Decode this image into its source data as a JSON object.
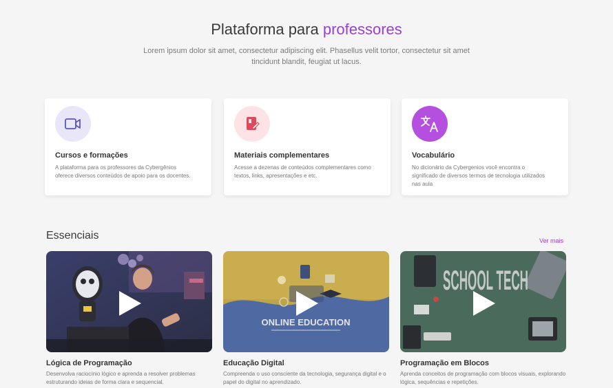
{
  "hero": {
    "title_main": "Plataforma para ",
    "title_accent": "professores",
    "subtitle": "Lorem ipsum dolor sit amet, consectetur adipiscing elit. Phasellus velit tortor, consectetur sit amet tincidunt blandit, feugiat ut lacus."
  },
  "features": [
    {
      "icon": "video-camera-icon",
      "icon_bg": "#e9e6f7",
      "icon_color": "#5b55c9",
      "title": "Cursos e formações",
      "description": "A plataforma para os professores da Cybergênios oferece diversos conteúdos de apoio para os docentes."
    },
    {
      "icon": "book-edit-icon",
      "icon_bg": "#fde3e6",
      "icon_color": "#e0495b",
      "title": "Materiais complementares",
      "description": "Acesse a dezenas de conteúdos complementares como textos, links, apresentações e etc."
    },
    {
      "icon": "translate-icon",
      "icon_bg": "#b44fe0",
      "icon_color": "#ffffff",
      "title": "Vocabulário",
      "description": "No dicionário da Cybergenios você encontra o significado de diversos termos de tecnologia utilizados nas aula"
    }
  ],
  "essentials": {
    "title": "Essenciais",
    "see_more": "Ver mais",
    "videos": [
      {
        "thumb_text": "",
        "title": "Lógica de Programação",
        "description": "Desenvolva raciocínio lógico e aprenda a resolver problemas estruturando ideias de forma clara e sequencial."
      },
      {
        "thumb_text": "ONLINE EDUCATION",
        "title": "Educação Digital",
        "description": "Compreenda o uso consciente da tecnologia, segurança digital e o papel do digital no aprendizado."
      },
      {
        "thumb_text": "SCHOOL TECH",
        "title": "Programação em Blocos",
        "description": "Aprenda conceitos de programação com blocos visuais, explorando lógica, sequências e repetições."
      }
    ]
  },
  "colors": {
    "accent": "#9b3fd1",
    "background": "#f5f5f6"
  }
}
